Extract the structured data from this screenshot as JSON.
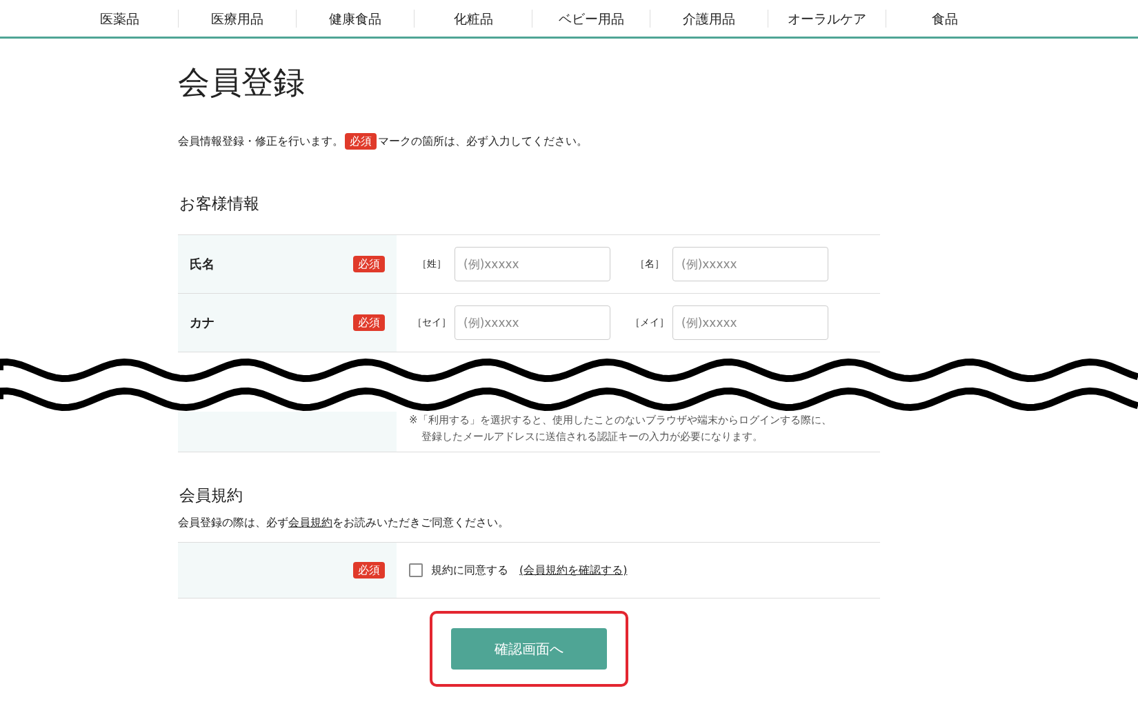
{
  "nav": [
    "医薬品",
    "医療用品",
    "健康食品",
    "化粧品",
    "ベビー用品",
    "介護用品",
    "オーラルケア",
    "食品"
  ],
  "title": "会員登録",
  "intro": {
    "before": "会員情報登録・修正を行います。",
    "badge": "必須",
    "after": "マークの箇所は、必ず入力してください。"
  },
  "customer": {
    "heading": "お客様情報",
    "rows": [
      {
        "label": "氏名",
        "badge": "必須",
        "fields": [
          {
            "prefix": "［姓］",
            "placeholder": "(例)xxxxx"
          },
          {
            "prefix": "［名］",
            "placeholder": "(例)xxxxx"
          }
        ]
      },
      {
        "label": "カナ",
        "badge": "必須",
        "fields": [
          {
            "prefix": "［セイ］",
            "placeholder": "(例)xxxxx"
          },
          {
            "prefix": "［メイ］",
            "placeholder": "(例)xxxxx"
          }
        ]
      }
    ],
    "note": [
      "※「利用する」を選択すると、使用したことのないブラウザや端末からログインする際に、",
      "登録したメールアドレスに送信される認証キーの入力が必要になります。"
    ]
  },
  "terms": {
    "heading": "会員規約",
    "text_before": "会員登録の際は、必ず",
    "text_link": "会員規約",
    "text_after": "をお読みいただきご同意ください。",
    "agree": {
      "badge": "必須",
      "checked": false,
      "label": "規約に同意する",
      "link": "(会員規約を確認する)"
    }
  },
  "submit": {
    "label": "確認画面へ",
    "highlighted": true
  }
}
